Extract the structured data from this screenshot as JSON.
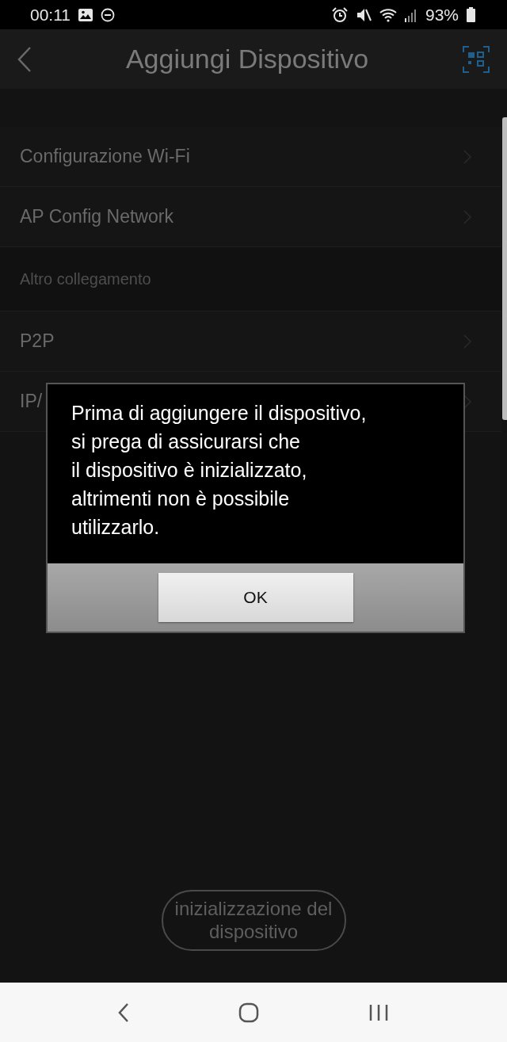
{
  "status_bar": {
    "time": "00:11",
    "battery": "93%"
  },
  "header": {
    "title": "Aggiungi Dispositivo"
  },
  "rows": [
    {
      "kind": "link",
      "label": "Configurazione Wi-Fi"
    },
    {
      "kind": "link",
      "label": "AP Config Network"
    },
    {
      "kind": "section",
      "label": "Altro collegamento"
    },
    {
      "kind": "link",
      "label": "P2P"
    },
    {
      "kind": "link",
      "label": "IP/"
    }
  ],
  "init_button": {
    "label": "inizializzazione del\ndispositivo"
  },
  "dialog": {
    "message": "Prima di aggiungere il dispositivo,\nsi prega di assicurarsi che\nil dispositivo è inizializzato,\naltrimenti non è possibile\nutilizzarlo.",
    "button": "OK"
  }
}
